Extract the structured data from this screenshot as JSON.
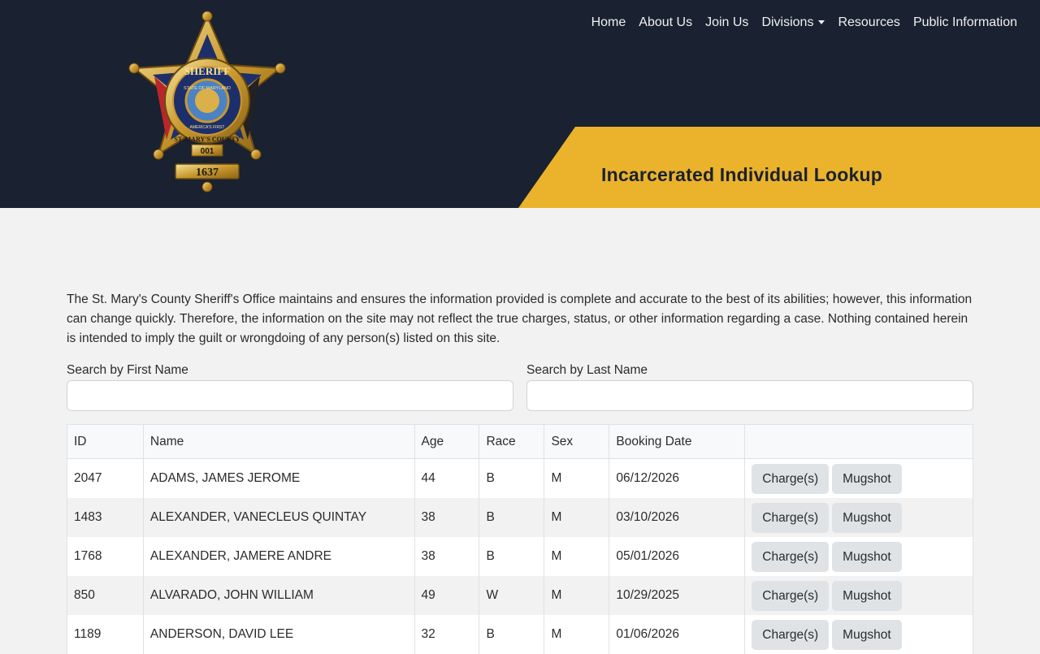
{
  "nav": {
    "items": [
      {
        "label": "Home"
      },
      {
        "label": "About Us"
      },
      {
        "label": "Join Us"
      },
      {
        "label": "Divisions",
        "dropdown": true
      },
      {
        "label": "Resources"
      },
      {
        "label": "Public Information"
      }
    ]
  },
  "logo": {
    "top_text": "SHERIFF",
    "ring_text": "STATE OF MARYLAND",
    "bottom_text": "ST. MARY'S COUNTY",
    "motto": "AMERICA'S FIRST",
    "badge_no": "001",
    "since": "SINCE",
    "year": "1637"
  },
  "banner": {
    "title": "Incarcerated Individual Lookup"
  },
  "disclaimer": "The St. Mary's County Sheriff's Office maintains and ensures the information provided is complete and accurate to the best of its abilities; however, this information can change quickly. Therefore, the information on the site may not reflect the true charges, status, or other information regarding a case. Nothing contained herein is intended to imply the guilt or wrongdoing of any person(s) listed on this site.",
  "search": {
    "first_label": "Search by First Name",
    "first_value": "",
    "last_label": "Search by Last Name",
    "last_value": ""
  },
  "table": {
    "headers": [
      "ID",
      "Name",
      "Age",
      "Race",
      "Sex",
      "Booking Date",
      ""
    ],
    "charges_label": "Charge(s)",
    "mugshot_label": "Mugshot",
    "rows": [
      {
        "id": "2047",
        "name": "ADAMS, JAMES JEROME",
        "age": "44",
        "race": "B",
        "sex": "M",
        "date": "06/12/2026"
      },
      {
        "id": "1483",
        "name": "ALEXANDER, VANECLEUS QUINTAY",
        "age": "38",
        "race": "B",
        "sex": "M",
        "date": "03/10/2026"
      },
      {
        "id": "1768",
        "name": "ALEXANDER, JAMERE ANDRE",
        "age": "38",
        "race": "B",
        "sex": "M",
        "date": "05/01/2026"
      },
      {
        "id": "850",
        "name": "ALVARADO, JOHN WILLIAM",
        "age": "49",
        "race": "W",
        "sex": "M",
        "date": "10/29/2025"
      },
      {
        "id": "1189",
        "name": "ANDERSON, DAVID LEE",
        "age": "32",
        "race": "B",
        "sex": "M",
        "date": "01/06/2026"
      }
    ]
  },
  "colors": {
    "header_bg": "#1a2130",
    "banner_gold": "#ebb32b",
    "page_bg": "#f2f2f2",
    "button_bg": "#e0e3e6"
  }
}
